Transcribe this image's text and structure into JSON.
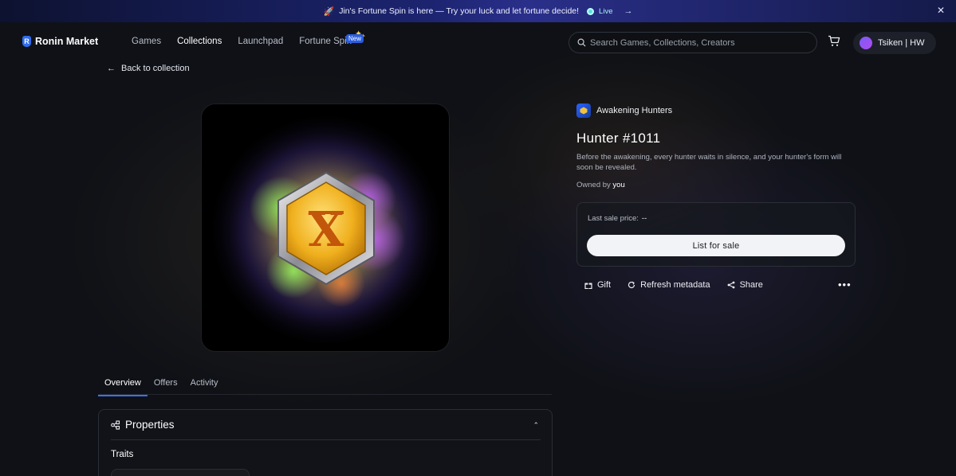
{
  "announcement": {
    "text": "Jin's Fortune Spin is here — Try your luck and let fortune decide!",
    "live_label": "Live"
  },
  "brand": {
    "logo_letter": "R",
    "name": "Ronin Market"
  },
  "nav": {
    "items": [
      {
        "label": "Games"
      },
      {
        "label": "Collections"
      },
      {
        "label": "Launchpad"
      },
      {
        "label": "Fortune Spin"
      }
    ],
    "active": "Collections",
    "new_badge": "New"
  },
  "search": {
    "placeholder": "Search Games, Collections, Creators",
    "value": ""
  },
  "user": {
    "name": "Tsiken | HW"
  },
  "back_link": "Back to collection",
  "collection": {
    "name": "Awakening Hunters"
  },
  "item": {
    "title": "Hunter #1011",
    "description": "Before the awakening, every hunter waits in silence, and your hunter's form will soon be revealed.",
    "owned_prefix": "Owned by",
    "owner": "you"
  },
  "sale": {
    "label": "Last sale price:",
    "value": "--",
    "list_button": "List for sale"
  },
  "actions": {
    "gift": "Gift",
    "refresh": "Refresh metadata",
    "share": "Share"
  },
  "tabs": [
    {
      "label": "Overview"
    },
    {
      "label": "Offers"
    },
    {
      "label": "Activity"
    }
  ],
  "properties": {
    "title": "Properties",
    "traits_label": "Traits"
  },
  "colors": {
    "accent": "#3e6ff0",
    "brand_blue": "#2f6cf0",
    "badge_gold": "#e8a91c"
  },
  "icons": [
    "rocket-icon",
    "arrow-right-icon",
    "close-icon",
    "search-icon",
    "cart-icon",
    "arrow-left-icon",
    "gift-icon",
    "refresh-icon",
    "share-icon",
    "more-icon",
    "properties-icon",
    "chevron-up-icon"
  ]
}
